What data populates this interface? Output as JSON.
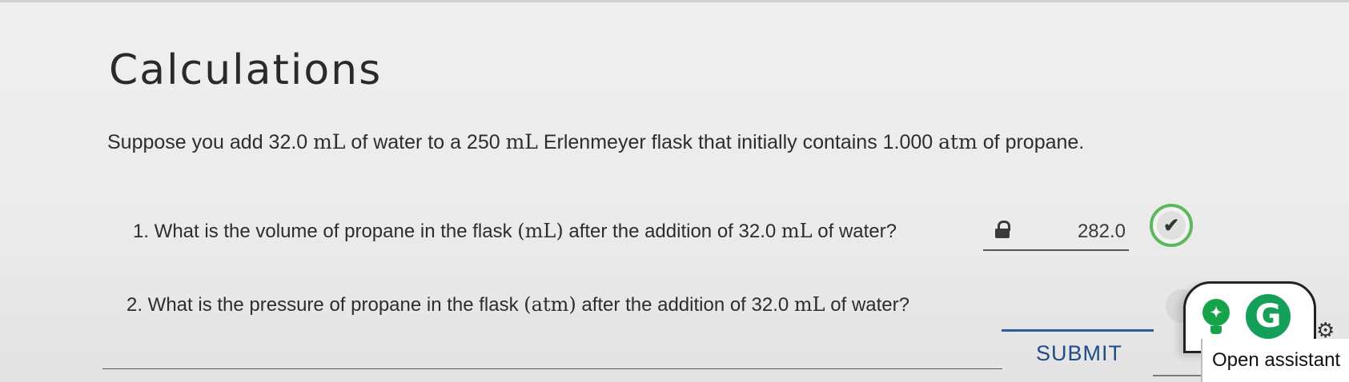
{
  "page": {
    "heading": "Calculations",
    "intro": {
      "pre": "Suppose you add 32.0 ",
      "u1": "mL",
      "mid1": " of water to a 250 ",
      "u2": "mL",
      "mid2": " Erlenmeyer flask that initially contains 1.000 ",
      "u3": "atm",
      "post": " of propane."
    }
  },
  "questions": [
    {
      "pre": "1. What is the volume of propane in the flask ",
      "unit": "(mL)",
      "mid": " after the addition of 32.0 ",
      "u2": "mL",
      "post": " of water?",
      "answer_value": "282.0",
      "status_icon": "check-icon"
    },
    {
      "pre": "2. What is the pressure of propane in the flask ",
      "unit": "(atm)",
      "mid": " after the addition of 32.0 ",
      "u2": "mL",
      "post": " of water?",
      "answer_value": "",
      "placeholder": ""
    }
  ],
  "actions": {
    "submit_label": "SUBMIT"
  },
  "assistant": {
    "open_label": "Open assistant",
    "grammarly_letter": "G",
    "icons": [
      "lightbulb-icon",
      "grammarly-icon",
      "gear-icon"
    ]
  },
  "colors": {
    "accent": "#1f4d86",
    "correct": "#5cb85c",
    "assistant_green": "#15a05a"
  }
}
